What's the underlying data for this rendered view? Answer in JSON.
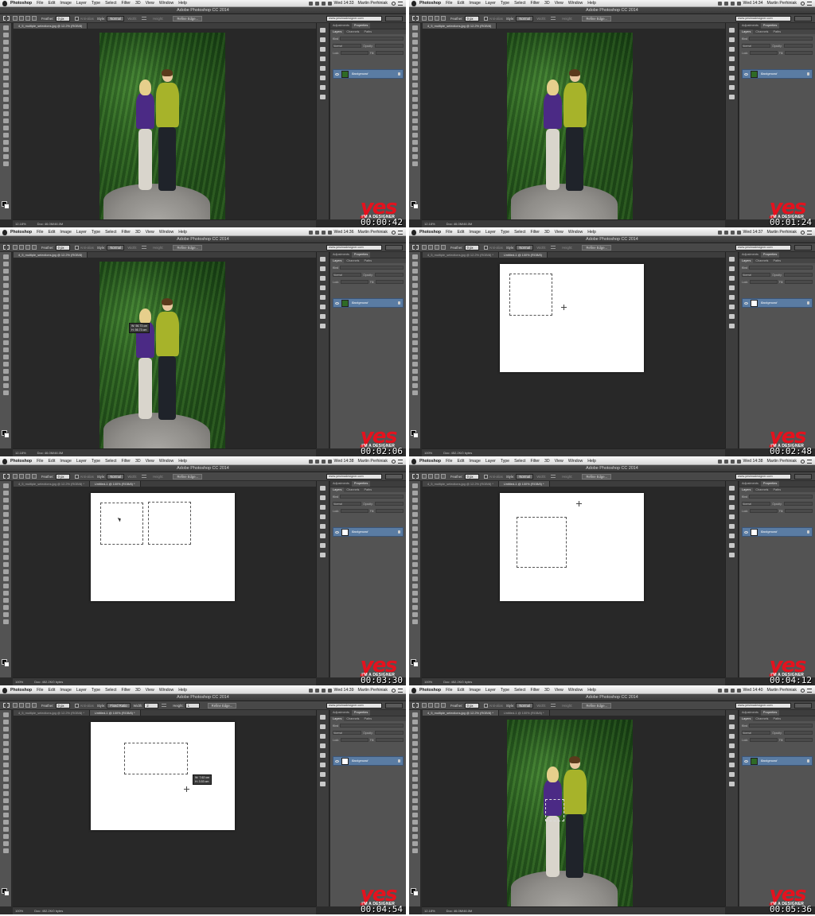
{
  "app": {
    "menu": [
      "Photoshop",
      "File",
      "Edit",
      "Image",
      "Layer",
      "Type",
      "Select",
      "Filter",
      "3D",
      "View",
      "Window",
      "Help"
    ],
    "user": "Martin Perhiniak",
    "window_title": "Adobe Photoshop CC 2014",
    "workspace_url": "www.yesimadesigner.com",
    "options": {
      "feather_label": "Feather:",
      "feather_value": "0 px",
      "antialias_label": "Anti-alias",
      "style_label": "Style:",
      "style_normal": "Normal",
      "style_fixed": "Fixed Ratio",
      "width_label": "Width:",
      "height_label": "Height:",
      "width_value": "2",
      "height_value": "1",
      "refine_label": "Refine Edge..."
    },
    "panel_tabs": [
      "Adjustments",
      "Properties"
    ],
    "layer_tabs": [
      "Layers",
      "Channels",
      "Paths"
    ],
    "layer_name": "Background",
    "kind_label": "Kind",
    "blend_mode": "Normal",
    "opacity_label": "Opacity:",
    "lock_label": "Lock:",
    "fill_label": "Fill:",
    "logo_text": "yes",
    "logo_sub": "I'M A DESIGNER"
  },
  "frames": [
    {
      "id": 1,
      "clock": "Wed 14:33",
      "tabs": [
        "4_5_multiple_selections.jpg @ 12.2% (RGB/8)"
      ],
      "active_tab": 0,
      "zoom": "12.18%",
      "doc_info": "Doc: 46.0M/46.0M",
      "timestamp": "00:00:42",
      "content": "photo",
      "style": "normal"
    },
    {
      "id": 2,
      "clock": "Wed 14:34",
      "tabs": [
        "4_5_multiple_selections.jpg @ 12.2% (RGB/8)"
      ],
      "active_tab": 0,
      "zoom": "12.18%",
      "doc_info": "Doc: 46.0M/46.0M",
      "timestamp": "00:01:24",
      "content": "photo",
      "style": "normal"
    },
    {
      "id": 3,
      "clock": "Wed 14:36",
      "tabs": [
        "4_5_multiple_selections.jpg @ 12.2% (RGB/8)"
      ],
      "active_tab": 0,
      "zoom": "12.18%",
      "doc_info": "Doc: 46.0M/46.0M",
      "timestamp": "00:02:06",
      "content": "photo",
      "style": "normal",
      "sizetip": "W: 56.73 cm\nH: 56.73 cm"
    },
    {
      "id": 4,
      "clock": "Wed 14:37",
      "tabs": [
        "4_5_multiple_selections.jpg @ 12.2% (RGB/8) *",
        "Untitled-1 @ 100% (RGB/8)"
      ],
      "active_tab": 1,
      "zoom": "100%",
      "doc_info": "Doc: 452.2K/0 bytes",
      "timestamp": "00:02:48",
      "content": "doc",
      "style": "normal"
    },
    {
      "id": 5,
      "clock": "Wed 14:38",
      "tabs": [
        "4_5_multiple_selections.jpg @ 12.2% (RGB/8) *",
        "Untitled-1 @ 100% (RGB/8) *"
      ],
      "active_tab": 1,
      "zoom": "100%",
      "doc_info": "Doc: 452.2K/0 bytes",
      "timestamp": "00:03:30",
      "content": "doc",
      "style": "normal"
    },
    {
      "id": 6,
      "clock": "Wed 14:38",
      "tabs": [
        "4_5_multiple_selections.jpg @ 12.2% (RGB/8) *",
        "Untitled-1 @ 100% (RGB/8) *"
      ],
      "active_tab": 1,
      "zoom": "100%",
      "doc_info": "Doc: 452.2K/0 bytes",
      "timestamp": "00:04:12",
      "content": "doc",
      "style": "normal"
    },
    {
      "id": 7,
      "clock": "Wed 14:39",
      "tabs": [
        "4_5_multiple_selections.jpg @ 12.2% (RGB/8) *",
        "Untitled-1 @ 100% (RGB/8) *"
      ],
      "active_tab": 1,
      "zoom": "100%",
      "doc_info": "Doc: 452.2K/0 bytes",
      "timestamp": "00:04:54",
      "content": "doc",
      "style": "fixed",
      "sizetip": "W: 7.62 cm\nH: 3.53 cm"
    },
    {
      "id": 8,
      "clock": "Wed 14:40",
      "tabs": [
        "4_5_multiple_selections.jpg @ 12.2% (RGB/8) *",
        "Untitled-1 @ 100% (RGB/8) *"
      ],
      "active_tab": 0,
      "zoom": "12.18%",
      "doc_info": "Doc: 46.0M/46.0M",
      "timestamp": "00:05:36",
      "content": "photo",
      "style": "normal"
    }
  ]
}
